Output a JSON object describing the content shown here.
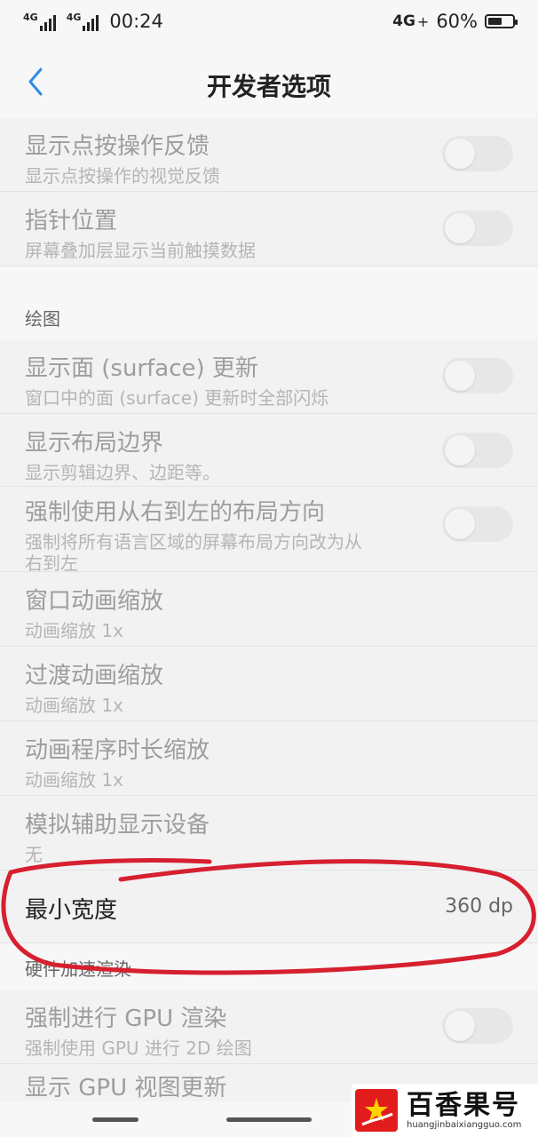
{
  "status_bar": {
    "signal1": "4G",
    "signal2": "4G",
    "time": "00:24",
    "network": "4G",
    "battery_percent": "60%"
  },
  "header": {
    "back_icon": "chevron-left-icon",
    "title": "开发者选项"
  },
  "rows_top": [
    {
      "title": "显示点按操作反馈",
      "subtitle": "显示点按操作的视觉反馈",
      "toggle": false
    },
    {
      "title": "指针位置",
      "subtitle": "屏幕叠加层显示当前触摸数据",
      "toggle": false
    }
  ],
  "section_drawing": {
    "header": "绘图",
    "rows": [
      {
        "title": "显示面 (surface) 更新",
        "subtitle": "窗口中的面 (surface) 更新时全部闪烁",
        "toggle": false
      },
      {
        "title": "显示布局边界",
        "subtitle": "显示剪辑边界、边距等。",
        "toggle": false
      },
      {
        "title": "强制使用从右到左的布局方向",
        "subtitle_line1": "强制将所有语言区域的屏幕布局方向改为从",
        "subtitle_line2": "右到左",
        "toggle": false
      },
      {
        "title": "窗口动画缩放",
        "subtitle": "动画缩放 1x"
      },
      {
        "title": "过渡动画缩放",
        "subtitle": "动画缩放 1x"
      },
      {
        "title": "动画程序时长缩放",
        "subtitle": "动画缩放 1x"
      },
      {
        "title": "模拟辅助显示设备",
        "subtitle": "无"
      },
      {
        "title": "最小宽度",
        "value": "360 dp"
      }
    ]
  },
  "section_hw": {
    "header": "硬件加速渲染",
    "rows": [
      {
        "title": "强制进行 GPU 渲染",
        "subtitle": "强制使用 GPU 进行 2D 绘图",
        "toggle": false
      },
      {
        "title": "显示 GPU 视图更新"
      }
    ]
  },
  "watermark": {
    "title": "百香果号",
    "url": "huangjinbaixiangguo.com"
  },
  "colors": {
    "accent": "#2e8de6",
    "annotation": "#d6202f",
    "background": "#f7f7f7"
  }
}
